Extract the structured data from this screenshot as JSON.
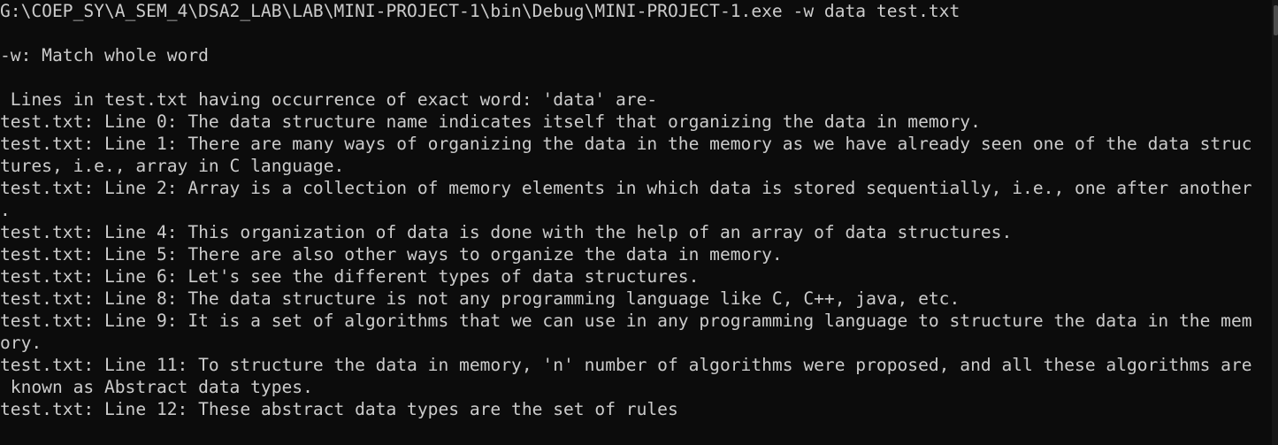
{
  "console": {
    "lines": [
      "G:\\COEP_SY\\A_SEM_4\\DSA2_LAB\\LAB\\MINI-PROJECT-1\\bin\\Debug\\MINI-PROJECT-1.exe -w data test.txt",
      "",
      "-w: Match whole word",
      "",
      " Lines in test.txt having occurrence of exact word: 'data' are-",
      "test.txt: Line 0: The data structure name indicates itself that organizing the data in memory.",
      "test.txt: Line 1: There are many ways of organizing the data in the memory as we have already seen one of the data struc",
      "tures, i.e., array in C language.",
      "test.txt: Line 2: Array is a collection of memory elements in which data is stored sequentially, i.e., one after another",
      ".",
      "test.txt: Line 4: This organization of data is done with the help of an array of data structures.",
      "test.txt: Line 5: There are also other ways to organize the data in memory.",
      "test.txt: Line 6: Let's see the different types of data structures.",
      "test.txt: Line 8: The data structure is not any programming language like C, C++, java, etc.",
      "test.txt: Line 9: It is a set of algorithms that we can use in any programming language to structure the data in the mem",
      "ory.",
      "test.txt: Line 11: To structure the data in memory, 'n' number of algorithms were proposed, and all these algorithms are",
      " known as Abstract data types.",
      "test.txt: Line 12: These abstract data types are the set of rules"
    ]
  },
  "colors": {
    "background": "#0c0c0c",
    "text": "#cccccc",
    "scrollbar_track": "#171717",
    "scrollbar_thumb": "#4d4d4d"
  }
}
